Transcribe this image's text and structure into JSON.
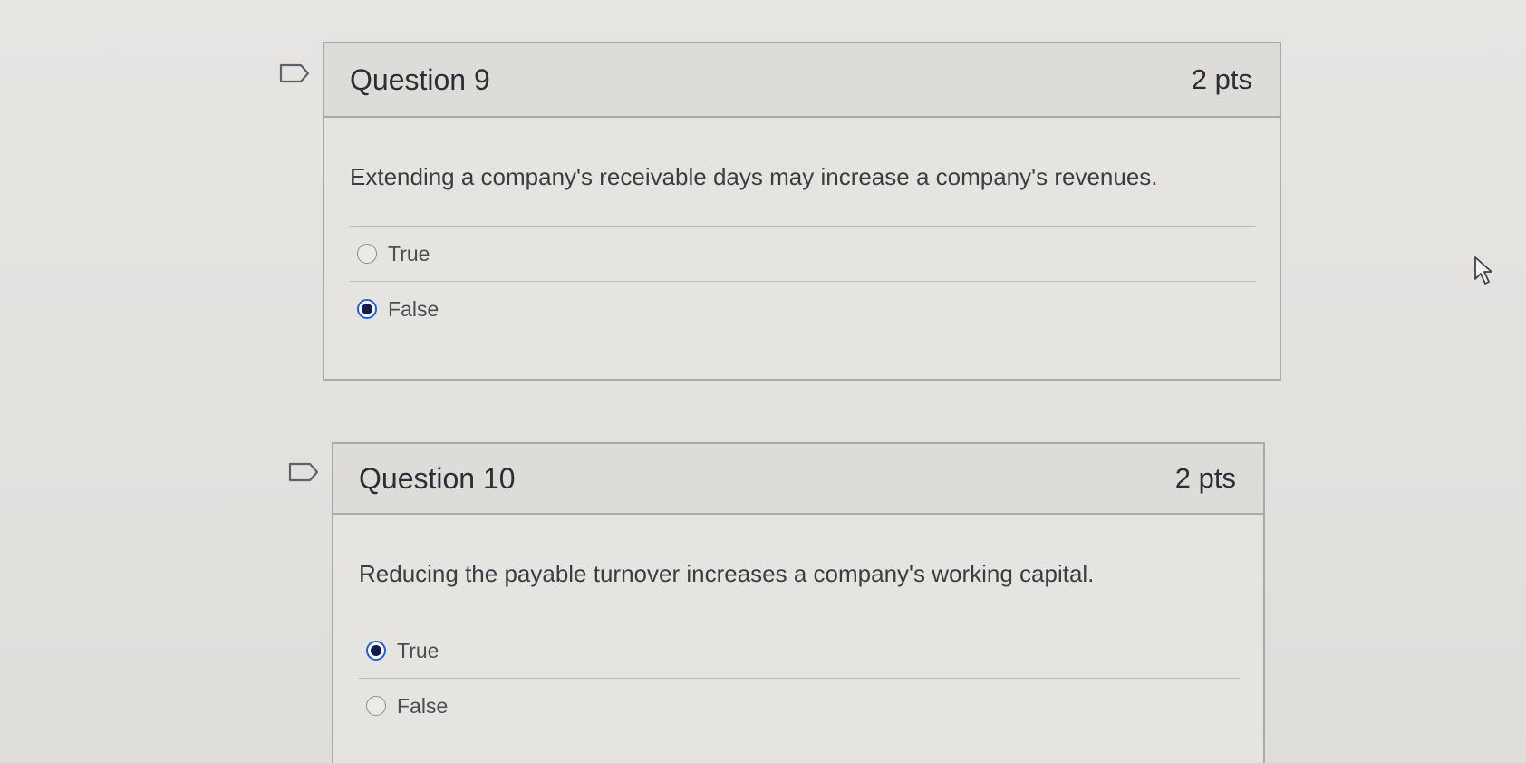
{
  "questions": [
    {
      "title": "Question 9",
      "points": "2 pts",
      "text": "Extending a company's receivable days may increase a company's revenues.",
      "answers": [
        {
          "label": "True",
          "selected": false
        },
        {
          "label": "False",
          "selected": true
        }
      ]
    },
    {
      "title": "Question 10",
      "points": "2 pts",
      "text": "Reducing the payable turnover increases a company's working capital.",
      "answers": [
        {
          "label": "True",
          "selected": true
        },
        {
          "label": "False",
          "selected": false
        }
      ]
    }
  ],
  "icons": {
    "flag": "flag-icon",
    "cursor": "mouse-pointer-icon"
  },
  "colors": {
    "selected_radio": "#101d4e",
    "selected_ring": "#1f5fd8"
  }
}
